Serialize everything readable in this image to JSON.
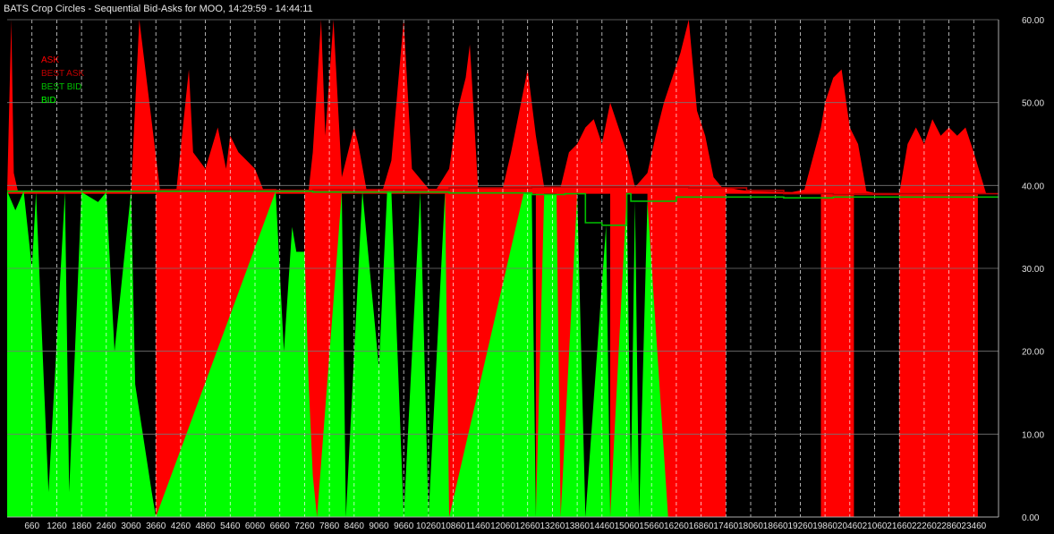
{
  "chart_data": {
    "type": "area",
    "title": "BATS Crop Circles - Sequential Bid-Asks for MOO, 14:29:59 - 14:44:11",
    "ylim": [
      0,
      60
    ],
    "yticks": [
      "60.00",
      "50.00",
      "40.00",
      "30.00",
      "20.00",
      "10.00",
      "0.00"
    ],
    "xlim": [
      60,
      24060
    ],
    "xticks": [
      "660",
      "1260",
      "1860",
      "2460",
      "3060",
      "3660",
      "4260",
      "4860",
      "5460",
      "6060",
      "6660",
      "7260",
      "7860",
      "8460",
      "9060",
      "9660",
      "10260",
      "10860",
      "11460",
      "12060",
      "12660",
      "13260",
      "13860",
      "14460",
      "15060",
      "15660",
      "16260",
      "16860",
      "17460",
      "18060",
      "18660",
      "19260",
      "19860",
      "20460",
      "21060",
      "21660",
      "22260",
      "22860",
      "23460"
    ],
    "grid": true,
    "legend_position": "top-left",
    "series": [
      {
        "name": "ASK",
        "color": "#ff0000",
        "x": [
          60,
          160,
          220,
          320,
          1060,
          1860,
          3060,
          3260,
          3760,
          3860,
          4060,
          4160,
          4460,
          4560,
          4860,
          5160,
          5360,
          5460,
          5660,
          5860,
          6060,
          6260,
          6560,
          6760,
          6960,
          7360,
          7460,
          7660,
          7760,
          7960,
          8160,
          8460,
          8560,
          8760,
          8960,
          9160,
          9360,
          9660,
          9860,
          10260,
          10460,
          10760,
          10960,
          11160,
          11260,
          11460,
          11560,
          12060,
          12260,
          12460,
          12660,
          12860,
          13060,
          13260,
          13460,
          13660,
          13860,
          14060,
          14260,
          14460,
          14660,
          15060,
          15260,
          15560,
          15760,
          15960,
          16160,
          16360,
          16560,
          16760,
          16960,
          17160,
          17360,
          17460,
          17760,
          18060,
          19060,
          19360,
          19760,
          19860,
          20060,
          20260,
          20460,
          20660,
          20860,
          21060,
          21660,
          21860,
          22060,
          22260,
          22460,
          22660,
          22860,
          23060,
          23260,
          23460,
          23760,
          24060
        ],
        "y": [
          39.2,
          60,
          41.5,
          39.3,
          39.3,
          39.4,
          39.4,
          60,
          39.5,
          39.5,
          39.5,
          39.6,
          54,
          44,
          42,
          47,
          42,
          46,
          44,
          43,
          42,
          39.5,
          39.5,
          39.4,
          39.4,
          39.5,
          44,
          60,
          46,
          60,
          41,
          47,
          45,
          39.5,
          39.5,
          39.6,
          43,
          60,
          42,
          39.6,
          39.6,
          42,
          49,
          53,
          57,
          39.7,
          39.7,
          39.7,
          44,
          49,
          54,
          46,
          39.8,
          39.8,
          39.8,
          44,
          45,
          47,
          48,
          45,
          50,
          44,
          39.8,
          41.5,
          46,
          50,
          53,
          56,
          60,
          49,
          46,
          41,
          39.8,
          39.8,
          39.5,
          39.3,
          39.2,
          39.5,
          47,
          50,
          53,
          54,
          47,
          45,
          39.3,
          39.1,
          39.1,
          45,
          47,
          45,
          48,
          46,
          47,
          46,
          47,
          44,
          39,
          39
        ],
        "fill": "area above best bid"
      },
      {
        "name": "BEST ASK",
        "color": "#c00000",
        "x": [
          60,
          3760,
          6560,
          7460,
          10760,
          12760,
          13560,
          14560,
          15060,
          16560,
          17960,
          18860,
          20060,
          21060,
          21660,
          24060
        ],
        "y": [
          39.3,
          39.5,
          39.4,
          39.5,
          39.7,
          39.8,
          39.8,
          39.8,
          39.8,
          39.7,
          39.4,
          39.0,
          38.9,
          38.9,
          39.0,
          39.0
        ]
      },
      {
        "name": "BEST BID",
        "color": "#00c000",
        "x": [
          60,
          3760,
          6560,
          7460,
          10760,
          12760,
          13560,
          14060,
          14160,
          14460,
          14560,
          15060,
          15160,
          15560,
          16260,
          16560,
          17960,
          18860,
          20060,
          21060,
          21660,
          24060
        ],
        "y": [
          39.3,
          39.3,
          39.3,
          39.2,
          39.1,
          38.9,
          39.0,
          35.5,
          35.5,
          35.2,
          35.2,
          39.0,
          38.1,
          38.1,
          38.6,
          38.6,
          38.6,
          38.5,
          38.6,
          38.6,
          38.6,
          38.6
        ]
      },
      {
        "name": "BID",
        "color": "#00ff00",
        "x": [
          60,
          260,
          460,
          660,
          760,
          960,
          1060,
          1460,
          1560,
          1860,
          2260,
          2460,
          2660,
          3060,
          3160,
          3560,
          3660,
          6560,
          6760,
          6960,
          7060,
          7260,
          7360,
          7460,
          7560,
          8160,
          8260,
          8660,
          9060,
          9260,
          9360,
          9660,
          10060,
          10260,
          10660,
          10760,
          12560,
          12760,
          12860,
          13060,
          13360,
          13460,
          13860,
          14060,
          14560,
          14660,
          15060,
          15160,
          15260,
          15360,
          15560,
          16060
        ],
        "y": [
          39.3,
          37,
          39.3,
          30,
          39.2,
          15,
          3,
          39.2,
          3,
          39.2,
          38,
          39.2,
          20,
          39.3,
          16,
          3,
          0,
          39.3,
          20,
          35,
          32,
          32,
          16,
          5,
          0,
          39.2,
          0,
          39.3,
          18,
          39.3,
          39.3,
          0,
          39.2,
          0,
          39.2,
          0,
          39.0,
          39.0,
          0,
          38.9,
          38.9,
          0,
          38.9,
          0,
          35.2,
          0,
          39.0,
          4,
          38.1,
          0,
          38.1,
          0
        ],
        "fill": "area below best bid"
      }
    ]
  }
}
